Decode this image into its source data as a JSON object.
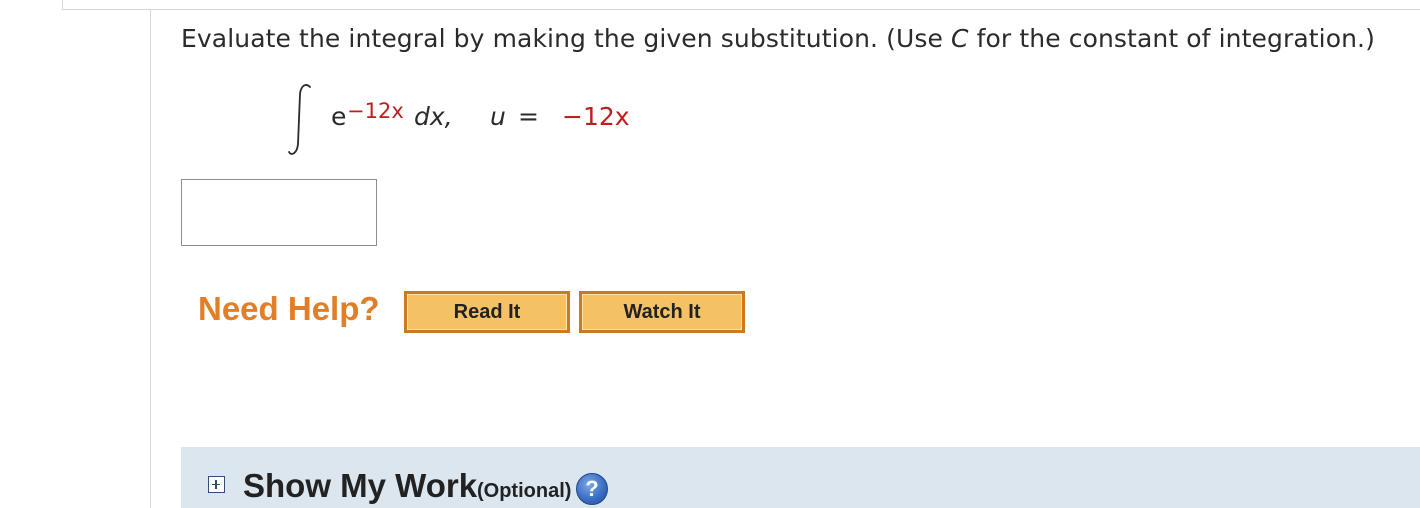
{
  "question": {
    "instruction_before": "Evaluate the integral by making the given substitution. (Use ",
    "instruction_var": "C",
    "instruction_after": " for the constant of integration.)",
    "integrand_base": "e",
    "integrand_exponent": "−12x",
    "differential": "dx,",
    "substitution_var": "u",
    "substitution_equals": "=",
    "substitution_value": "−12x"
  },
  "answer": {
    "value": "",
    "placeholder": ""
  },
  "help": {
    "label": "Need Help?",
    "read_it": "Read It",
    "watch_it": "Watch It"
  },
  "show_work": {
    "title": "Show My Work",
    "optional": "(Optional)",
    "help_glyph": "?"
  },
  "colors": {
    "accent_red": "#c21d1d",
    "need_help_orange": "#e07f28",
    "button_fill": "#f4c264",
    "button_border": "#cc7a1f",
    "panel_bg": "#dce6ee",
    "help_icon_blue": "#3a6fc4"
  },
  "icons": {
    "expand": "plus-square-icon",
    "help": "question-circle-icon",
    "integral": "integral-sign-icon"
  }
}
